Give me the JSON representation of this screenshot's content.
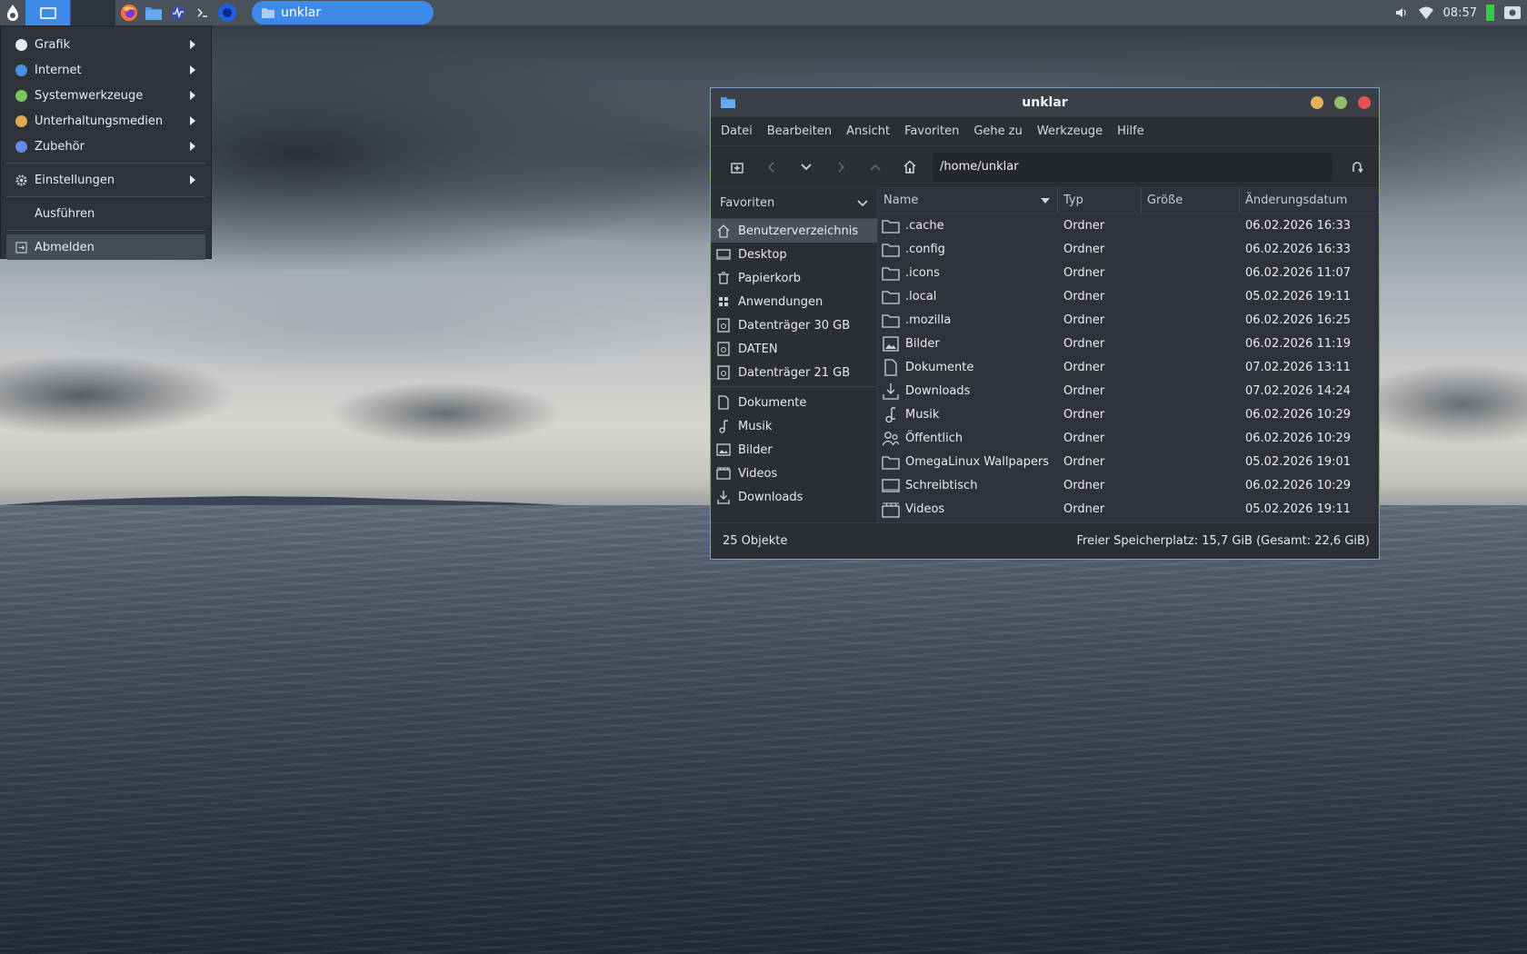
{
  "panel": {
    "task_title": "unklar",
    "clock": "08:57",
    "colors": {
      "active_blue": "#3d8be6",
      "battery_green": "#2fd040"
    },
    "launchers": [
      "firefox-icon",
      "file-manager-icon",
      "system-monitor-icon",
      "terminal-icon",
      "settings-circle-icon"
    ]
  },
  "app_menu": {
    "items": [
      {
        "label": "Grafik",
        "icon": "graphics-icon",
        "submenu": true
      },
      {
        "label": "Internet",
        "icon": "internet-icon",
        "submenu": true
      },
      {
        "label": "Systemwerkzeuge",
        "icon": "system-tools-icon",
        "submenu": true
      },
      {
        "label": "Unterhaltungsmedien",
        "icon": "multimedia-icon",
        "submenu": true
      },
      {
        "label": "Zubehör",
        "icon": "accessories-icon",
        "submenu": true
      },
      {
        "label": "Einstellungen",
        "icon": "gear-icon",
        "submenu": true
      },
      {
        "label": "Ausführen",
        "icon": "",
        "submenu": false
      },
      {
        "label": "Abmelden",
        "icon": "logout-icon",
        "submenu": false
      }
    ]
  },
  "window": {
    "title": "unklar",
    "menubar": [
      "Datei",
      "Bearbeiten",
      "Ansicht",
      "Favoriten",
      "Gehe zu",
      "Werkzeuge",
      "Hilfe"
    ],
    "path": "/home/unklar",
    "sidebar": {
      "header": "Favoriten",
      "places": [
        {
          "label": "Benutzerverzeichnis",
          "icon": "home-icon",
          "selected": true
        },
        {
          "label": "Desktop",
          "icon": "desktop-icon"
        },
        {
          "label": "Papierkorb",
          "icon": "trash-icon"
        },
        {
          "label": "Anwendungen",
          "icon": "apps-icon"
        },
        {
          "label": "Datenträger 30 GB",
          "icon": "drive-icon"
        },
        {
          "label": "DATEN",
          "icon": "drive-icon"
        },
        {
          "label": "Datenträger 21 GB",
          "icon": "drive-icon"
        }
      ],
      "bookmarks": [
        {
          "label": "Dokumente",
          "icon": "document-icon"
        },
        {
          "label": "Musik",
          "icon": "music-icon"
        },
        {
          "label": "Bilder",
          "icon": "image-icon"
        },
        {
          "label": "Videos",
          "icon": "video-icon"
        },
        {
          "label": "Downloads",
          "icon": "download-icon"
        }
      ]
    },
    "columns": {
      "name": "Name",
      "type": "Typ",
      "size": "Größe",
      "date": "Änderungsdatum"
    },
    "files": [
      {
        "name": ".cache",
        "type": "Ordner",
        "size": "",
        "date": "06.02.2026 16:33",
        "icon": "folder-icon"
      },
      {
        "name": ".config",
        "type": "Ordner",
        "size": "",
        "date": "06.02.2026 16:33",
        "icon": "folder-icon"
      },
      {
        "name": ".icons",
        "type": "Ordner",
        "size": "",
        "date": "06.02.2026 11:07",
        "icon": "folder-icon"
      },
      {
        "name": ".local",
        "type": "Ordner",
        "size": "",
        "date": "05.02.2026 19:11",
        "icon": "folder-icon"
      },
      {
        "name": ".mozilla",
        "type": "Ordner",
        "size": "",
        "date": "06.02.2026 16:25",
        "icon": "folder-icon"
      },
      {
        "name": "Bilder",
        "type": "Ordner",
        "size": "",
        "date": "06.02.2026 11:19",
        "icon": "image-icon"
      },
      {
        "name": "Dokumente",
        "type": "Ordner",
        "size": "",
        "date": "07.02.2026 13:11",
        "icon": "document-icon"
      },
      {
        "name": "Downloads",
        "type": "Ordner",
        "size": "",
        "date": "07.02.2026 14:24",
        "icon": "download-icon"
      },
      {
        "name": "Musik",
        "type": "Ordner",
        "size": "",
        "date": "06.02.2026 10:29",
        "icon": "music-icon"
      },
      {
        "name": "Öffentlich",
        "type": "Ordner",
        "size": "",
        "date": "06.02.2026 10:29",
        "icon": "public-share-icon"
      },
      {
        "name": "OmegaLinux Wallpapers",
        "type": "Ordner",
        "size": "",
        "date": "05.02.2026 19:01",
        "icon": "folder-icon"
      },
      {
        "name": "Schreibtisch",
        "type": "Ordner",
        "size": "",
        "date": "06.02.2026 10:29",
        "icon": "desktop-icon"
      },
      {
        "name": "Videos",
        "type": "Ordner",
        "size": "",
        "date": "05.02.2026 19:11",
        "icon": "video-icon"
      }
    ],
    "status_left": "25 Objekte",
    "status_right": "Freier Speicherplatz: 15,7 GiB (Gesamt: 22,6 GiB)"
  }
}
